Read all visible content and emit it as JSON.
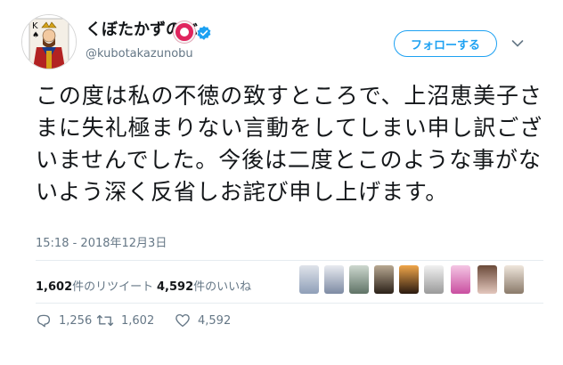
{
  "user": {
    "display_name": "くぼたかずのぶ",
    "handle": "@kubotakazunobu"
  },
  "header": {
    "follow_label": "フォローする"
  },
  "tweet": {
    "text": "この度は私の不徳の致すところで、上沼恵美子さまに失礼極まりない言動をしてしまい申し訳ございませんでした。今後は二度とこのような事がないよう深く反省しお詫び申し上げます。",
    "timestamp": "15:18 - 2018年12月3日"
  },
  "stats": {
    "retweets_count": "1,602",
    "retweets_label": "件のリツイート",
    "likes_count": "4,592",
    "likes_label": "件のいいね"
  },
  "actions": {
    "reply_count": "1,256",
    "retweet_count": "1,602",
    "like_count": "4,592"
  },
  "colors": {
    "accent": "#1da1f2",
    "muted": "#657786",
    "text": "#14171a"
  }
}
